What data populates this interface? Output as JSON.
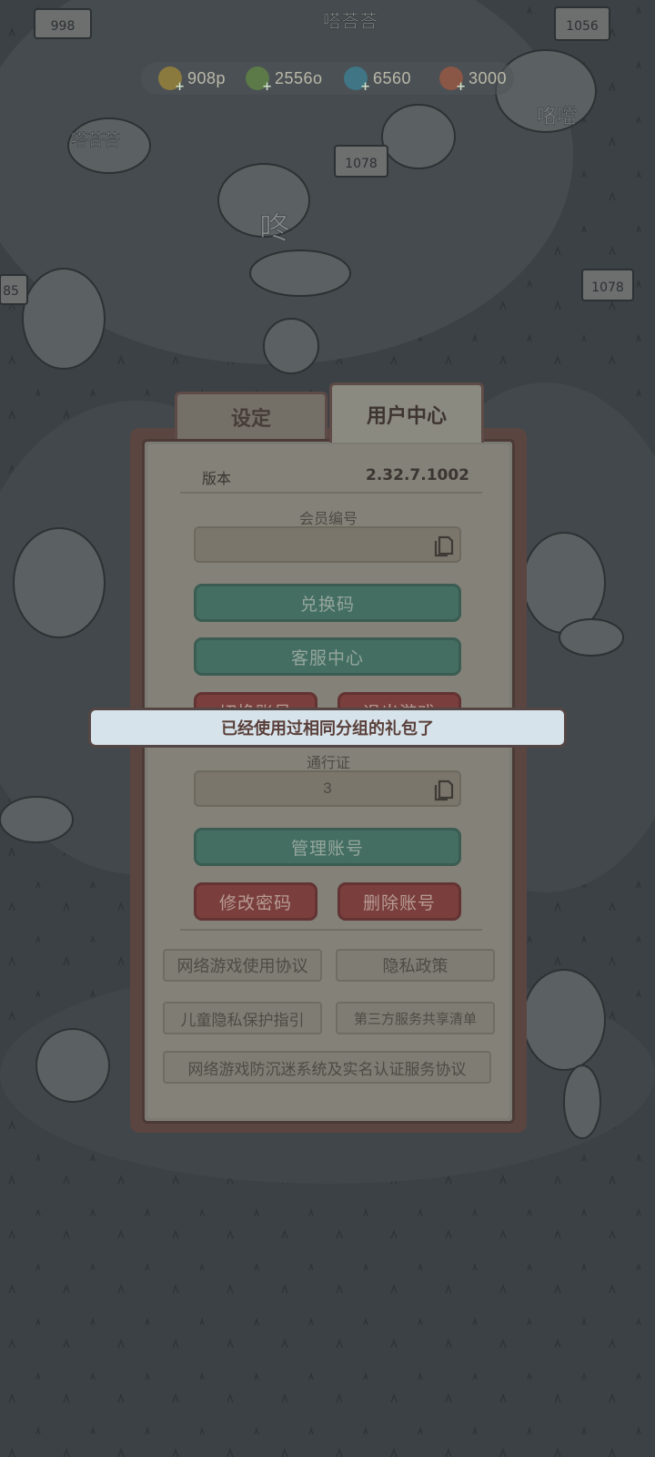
{
  "resources": {
    "coin": "908p",
    "energy": "2556o",
    "gem": "6560",
    "ticket": "3000"
  },
  "tabs": {
    "settings": "设定",
    "user_center": "用户中心"
  },
  "version": {
    "label": "版本",
    "value": "2.32.7.1002"
  },
  "member": {
    "label": "会员编号",
    "value": ""
  },
  "buttons": {
    "redeem_code": "兑换码",
    "customer_service": "客服中心",
    "switch_account": "切换账号",
    "exit_game": "退出游戏",
    "manage_account": "管理账号",
    "change_password": "修改密码",
    "delete_account": "删除账号"
  },
  "pass": {
    "label": "通行证",
    "value": "3"
  },
  "links": {
    "user_agreement": "网络游戏使用协议",
    "privacy_policy": "隐私政策",
    "child_privacy": "儿童隐私保护指引",
    "third_party": "第三方服务共享清单",
    "anti_addiction": "网络游戏防沉迷系统及实名认证服务协议"
  },
  "toast": {
    "message": "已经使用过相同分组的礼包了"
  },
  "scene_text": {
    "sign_998": "998",
    "sign_1056": "1056",
    "sign_1078a": "1078",
    "sign_1078b": "1078",
    "sign_85": "85",
    "sfx_1": "嗒荅荅",
    "sfx_2": "嗒荅荅",
    "sfx_3": "咚",
    "sfx_4": "咯噹"
  },
  "colors": {
    "background": "#3b4145",
    "panel": "#838178",
    "green_button": "#456e62",
    "red_button": "#7a3f3d",
    "toast_bg": "#d7e3ea"
  }
}
